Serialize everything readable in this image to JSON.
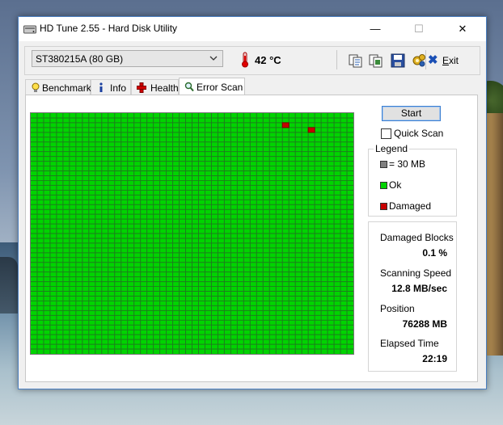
{
  "window": {
    "title": "HD Tune 2.55 - Hard Disk Utility",
    "minimize": "—",
    "maximize": "☐",
    "close": "✕"
  },
  "toolbar": {
    "drive": "ST380215A (80 GB)",
    "temperature": "42 °C",
    "exit_mnemonic": "E",
    "exit_rest": "xit",
    "icons": [
      "copy-text-icon",
      "copy-screen-icon",
      "save-icon",
      "options-icon"
    ]
  },
  "tabs": [
    {
      "label": "Benchmark",
      "icon": "lightbulb-icon",
      "active": false
    },
    {
      "label": "Info",
      "icon": "info-icon",
      "active": false
    },
    {
      "label": "Health",
      "icon": "health-cross-icon",
      "active": false
    },
    {
      "label": "Error Scan",
      "icon": "magnifier-icon",
      "active": true
    }
  ],
  "scan": {
    "start_label": "Start",
    "quick_scan_label": "Quick Scan",
    "quick_scan_checked": false,
    "grid": {
      "columns": 50,
      "rows": 50,
      "damaged": [
        [
          2,
          39
        ],
        [
          3,
          43
        ]
      ]
    }
  },
  "legend": {
    "title": "Legend",
    "items": [
      {
        "label": "= 30 MB",
        "color": "#808080"
      },
      {
        "label": "Ok",
        "color": "#00d400"
      },
      {
        "label": "Damaged",
        "color": "#c80000"
      }
    ]
  },
  "stats": {
    "damaged_blocks_label": "Damaged Blocks",
    "damaged_blocks_value": "0.1 %",
    "scanning_speed_label": "Scanning Speed",
    "scanning_speed_value": "12.8 MB/sec",
    "position_label": "Position",
    "position_value": "76288 MB",
    "elapsed_label": "Elapsed Time",
    "elapsed_value": "22:19"
  },
  "colors": {
    "ok": "#00d400",
    "damaged": "#c80000",
    "accent": "#3c7fd1"
  }
}
